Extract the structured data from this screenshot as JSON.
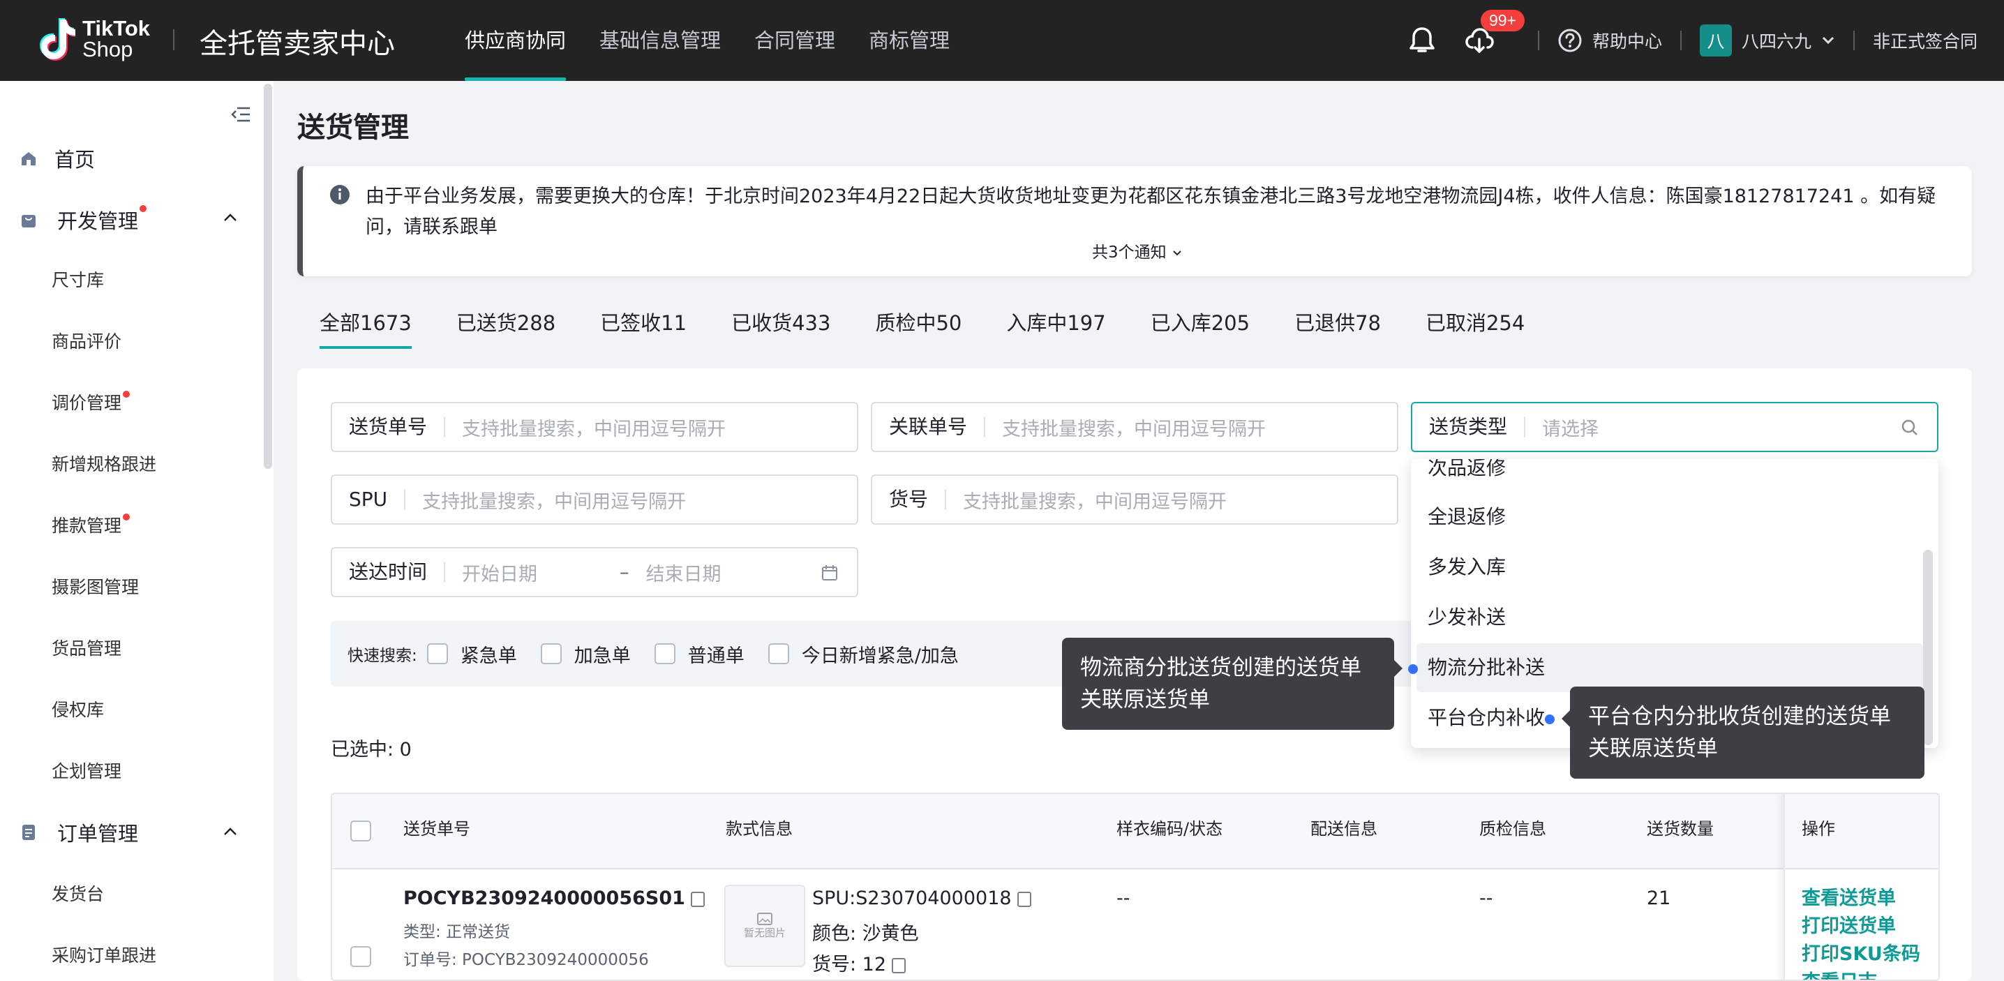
{
  "header": {
    "logo_line1": "TikTok",
    "logo_line2": "Shop",
    "app_title": "全托管卖家中心",
    "nav": [
      {
        "label": "供应商协同",
        "active": true
      },
      {
        "label": "基础信息管理"
      },
      {
        "label": "合同管理"
      },
      {
        "label": "商标管理"
      }
    ],
    "notification_badge": "99+",
    "help_label": "帮助中心",
    "user_avatar": "八",
    "user_name": "八四六九",
    "contract_status": "非正式签合同"
  },
  "sidebar": {
    "home": "首页",
    "dev_group": "开发管理",
    "dev_items": [
      "尺寸库",
      "商品评价",
      "调价管理",
      "新增规格跟进",
      "推款管理",
      "摄影图管理",
      "货品管理",
      "侵权库",
      "企划管理"
    ],
    "order_group": "订单管理",
    "order_items": [
      "发货台",
      "采购订单跟进"
    ]
  },
  "page": {
    "title": "送货管理",
    "notice": "由于平台业务发展，需要更换大的仓库！于北京时间2023年4月22日起大货收货地址变更为花都区花东镇金港北三路3号龙地空港物流园J4栋，收件人信息：陈国豪18127817241 。如有疑问，请联系跟单",
    "notice_more": "共3个通知"
  },
  "tabs": [
    {
      "label": "全部1673",
      "active": true
    },
    {
      "label": "已送货288"
    },
    {
      "label": "已签收11"
    },
    {
      "label": "已收货433"
    },
    {
      "label": "质检中50"
    },
    {
      "label": "入库中197"
    },
    {
      "label": "已入库205"
    },
    {
      "label": "已退供78"
    },
    {
      "label": "已取消254"
    }
  ],
  "filters": {
    "delivery_no": {
      "label": "送货单号",
      "placeholder": "支持批量搜索，中间用逗号隔开"
    },
    "related_no": {
      "label": "关联单号",
      "placeholder": "支持批量搜索，中间用逗号隔开"
    },
    "delivery_type": {
      "label": "送货类型",
      "placeholder": "请选择"
    },
    "spu": {
      "label": "SPU",
      "placeholder": "支持批量搜索，中间用逗号隔开"
    },
    "item_no": {
      "label": "货号",
      "placeholder": "支持批量搜索，中间用逗号隔开"
    },
    "arrival_time": {
      "label": "送达时间",
      "start": "开始日期",
      "sep": "–",
      "end": "结束日期"
    }
  },
  "quick_search": {
    "label": "快速搜索:",
    "options": [
      "紧急单",
      "加急单",
      "普通单",
      "今日新增紧急/加急"
    ]
  },
  "selected_count": "已选中: 0",
  "dropdown": {
    "items": [
      "次品返修",
      "全退返修",
      "多发入库",
      "少发补送",
      "物流分批补送",
      "平台仓内补收"
    ],
    "highlighted_index": 4
  },
  "tooltips": {
    "logistics": [
      "物流商分批送货创建的送货单",
      "关联原送货单"
    ],
    "platform": [
      "平台仓内分批收货创建的送货单",
      "关联原送货单"
    ]
  },
  "table": {
    "columns": [
      "送货单号",
      "款式信息",
      "样衣编码/状态",
      "配送信息",
      "质检信息",
      "送货数量",
      "操作"
    ],
    "rows": [
      {
        "delivery_no": "POCYB2309240000056S01",
        "type": "类型: 正常送货",
        "order_no": "订单号: POCYB2309240000056",
        "thumb_text": "暂无图片",
        "spu": "SPU:S230704000018",
        "color": "颜色: 沙黄色",
        "item_no": "货号: 12",
        "sample": "--",
        "qc": "--",
        "qty": "21",
        "actions": [
          "查看送货单",
          "打印送货单",
          "打印SKU条码",
          "查看日志"
        ]
      }
    ]
  }
}
